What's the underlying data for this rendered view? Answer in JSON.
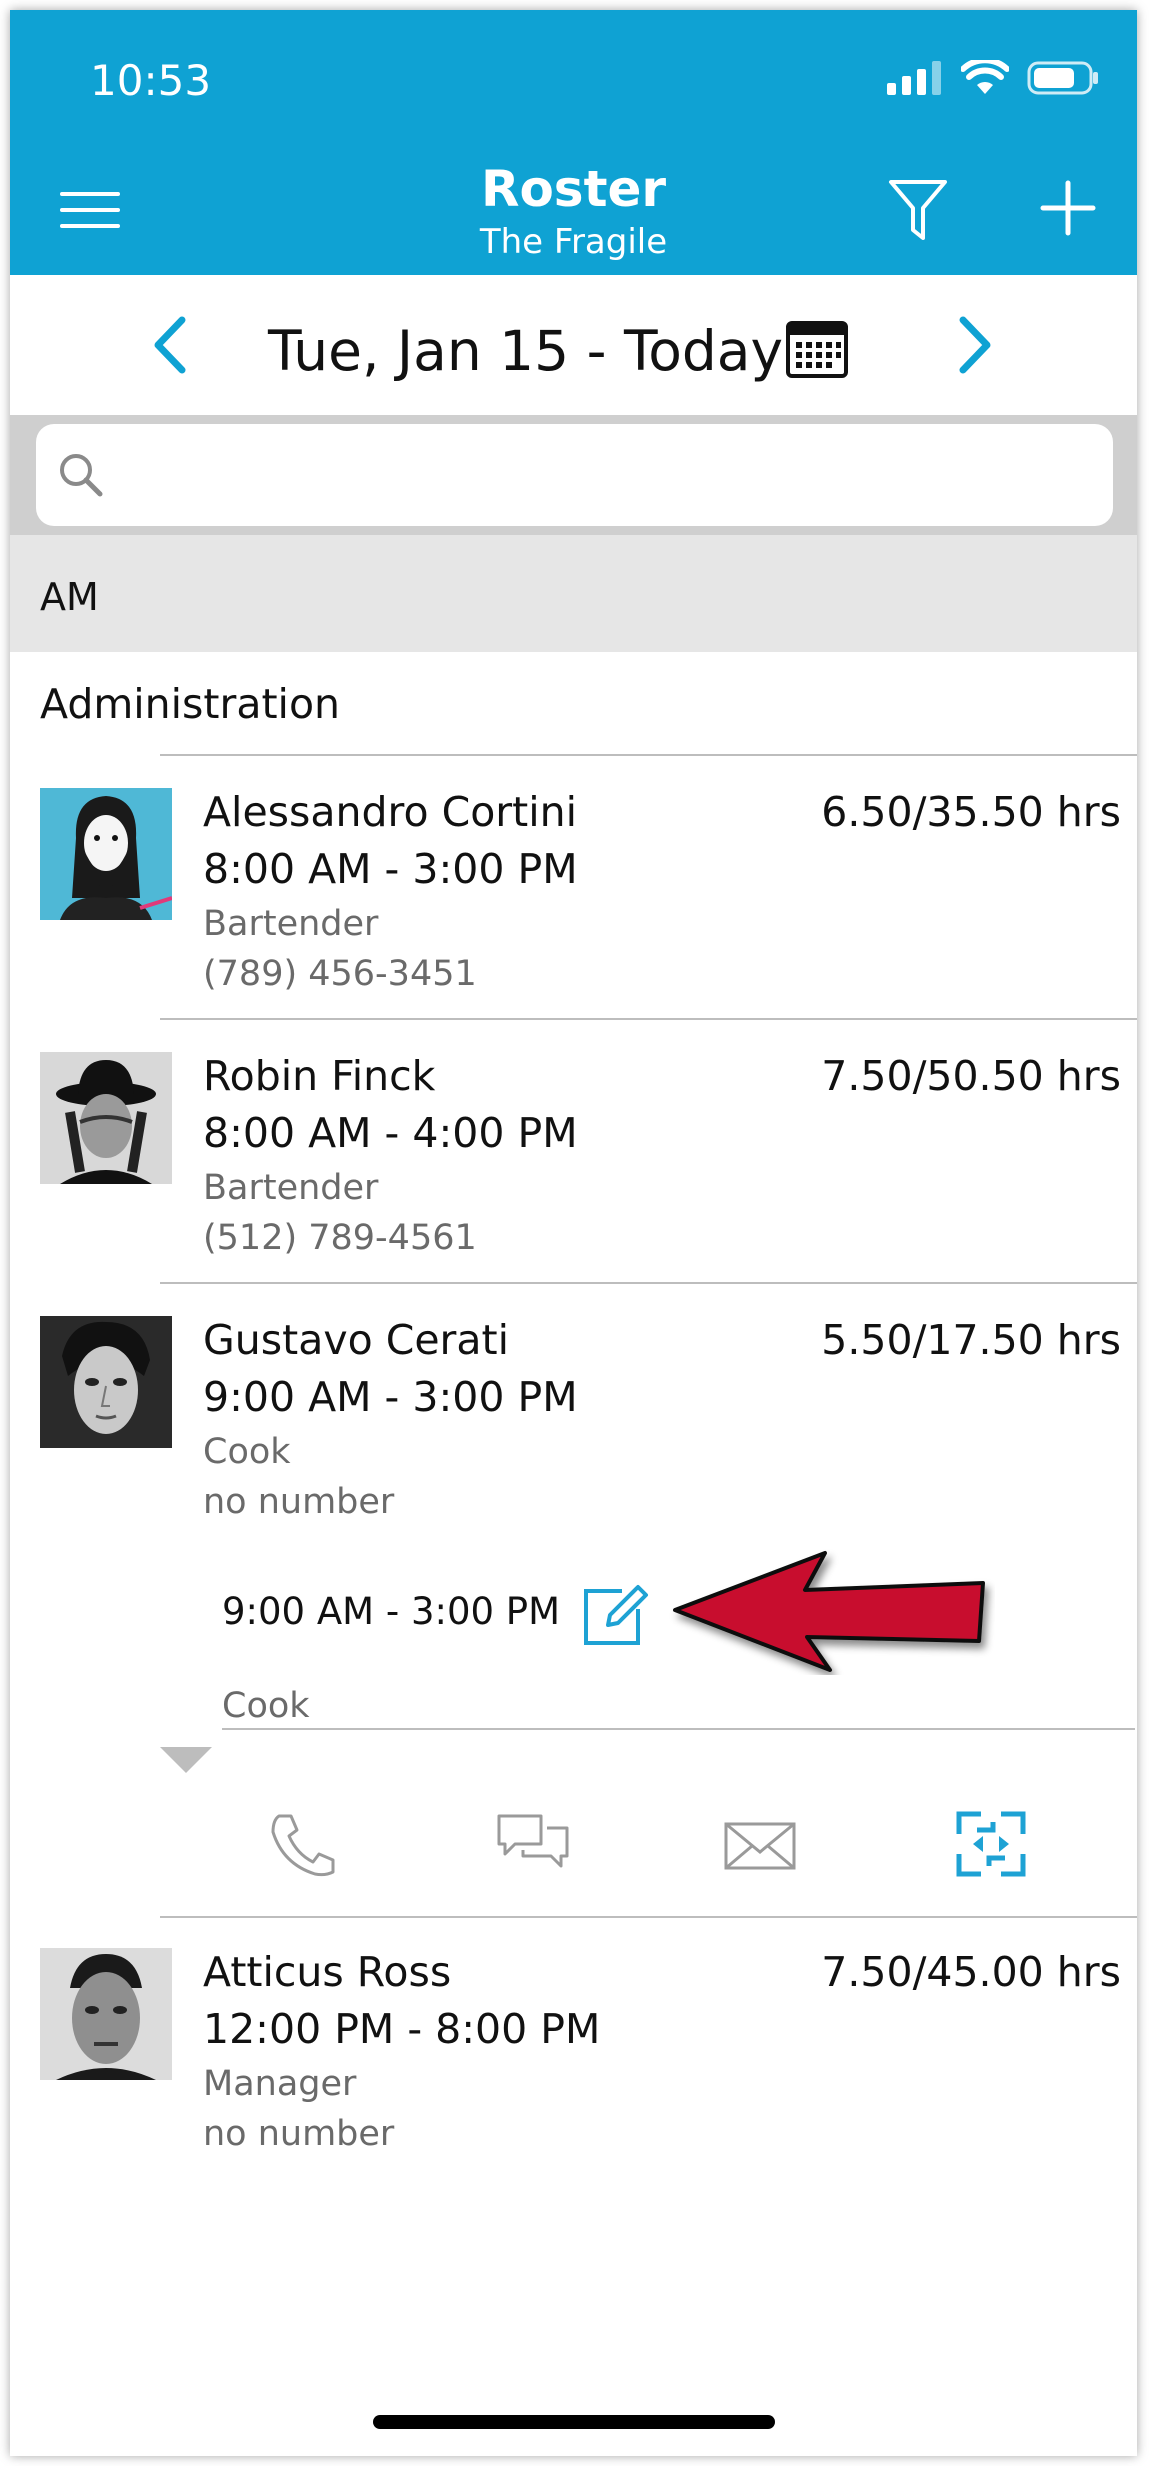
{
  "status_bar": {
    "time": "10:53"
  },
  "header": {
    "title": "Roster",
    "subtitle": "The Fragile"
  },
  "date_nav": {
    "label": "Tue, Jan 15 - Today"
  },
  "search": {
    "placeholder": ""
  },
  "section": {
    "label": "AM"
  },
  "group": {
    "label": "Administration"
  },
  "employees": [
    {
      "name": "Alessandro Cortini",
      "time": "8:00 AM - 3:00 PM",
      "role": "Bartender",
      "phone": "(789) 456-3451",
      "hours": "6.50/35.50 hrs"
    },
    {
      "name": "Robin Finck",
      "time": "8:00 AM - 4:00 PM",
      "role": "Bartender",
      "phone": "(512) 789-4561",
      "hours": "7.50/50.50 hrs"
    },
    {
      "name": "Gustavo Cerati",
      "time": "9:00 AM - 3:00 PM",
      "role": "Cook",
      "phone": "no number",
      "hours": "5.50/17.50 hrs"
    },
    {
      "name": "Atticus Ross",
      "time": "12:00 PM - 8:00 PM",
      "role": "Manager",
      "phone": "no number",
      "hours": "7.50/45.00 hrs"
    }
  ],
  "expanded_shift": {
    "time": "9:00 AM - 3:00 PM",
    "role": "Cook"
  },
  "actions": [
    "phone-icon",
    "chat-icon",
    "mail-icon",
    "swap-icon"
  ],
  "colors": {
    "brand": "#0fa2d3",
    "arrow": "#c8102e",
    "section_bg": "#e6e6e6"
  }
}
